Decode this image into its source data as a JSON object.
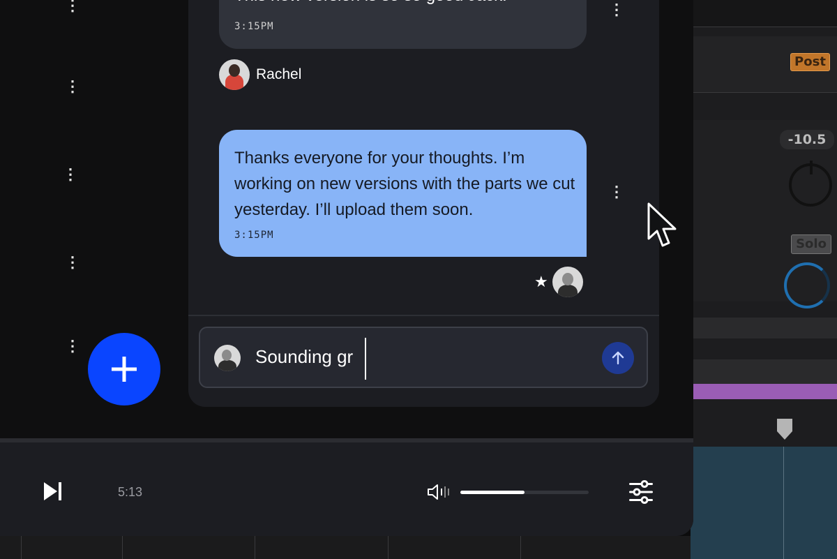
{
  "background_daw": {
    "post_label": "Post",
    "value_label": "-10.5",
    "solo_label": "Solo"
  },
  "chat": {
    "previous_message": {
      "text": "This new version is so so good Jack!",
      "time": "3:15PM"
    },
    "sender": {
      "name": "Rachel"
    },
    "message": {
      "text": "Thanks everyone for your thoughts. I’m working on new versions with the parts we cut yesterday. I’ll upload them soon.",
      "time": "3:15PM"
    },
    "reaction": {
      "icon": "star-icon"
    },
    "composer": {
      "value": "Sounding gr"
    }
  },
  "player": {
    "elapsed": "5:13",
    "volume_level": 0.5
  },
  "colors": {
    "accent_blue": "#0a45ff",
    "bubble_blue": "#88b4f7",
    "panel": "#1c1d22",
    "daw_post": "#c2762a",
    "daw_purple": "#9a5db5"
  }
}
